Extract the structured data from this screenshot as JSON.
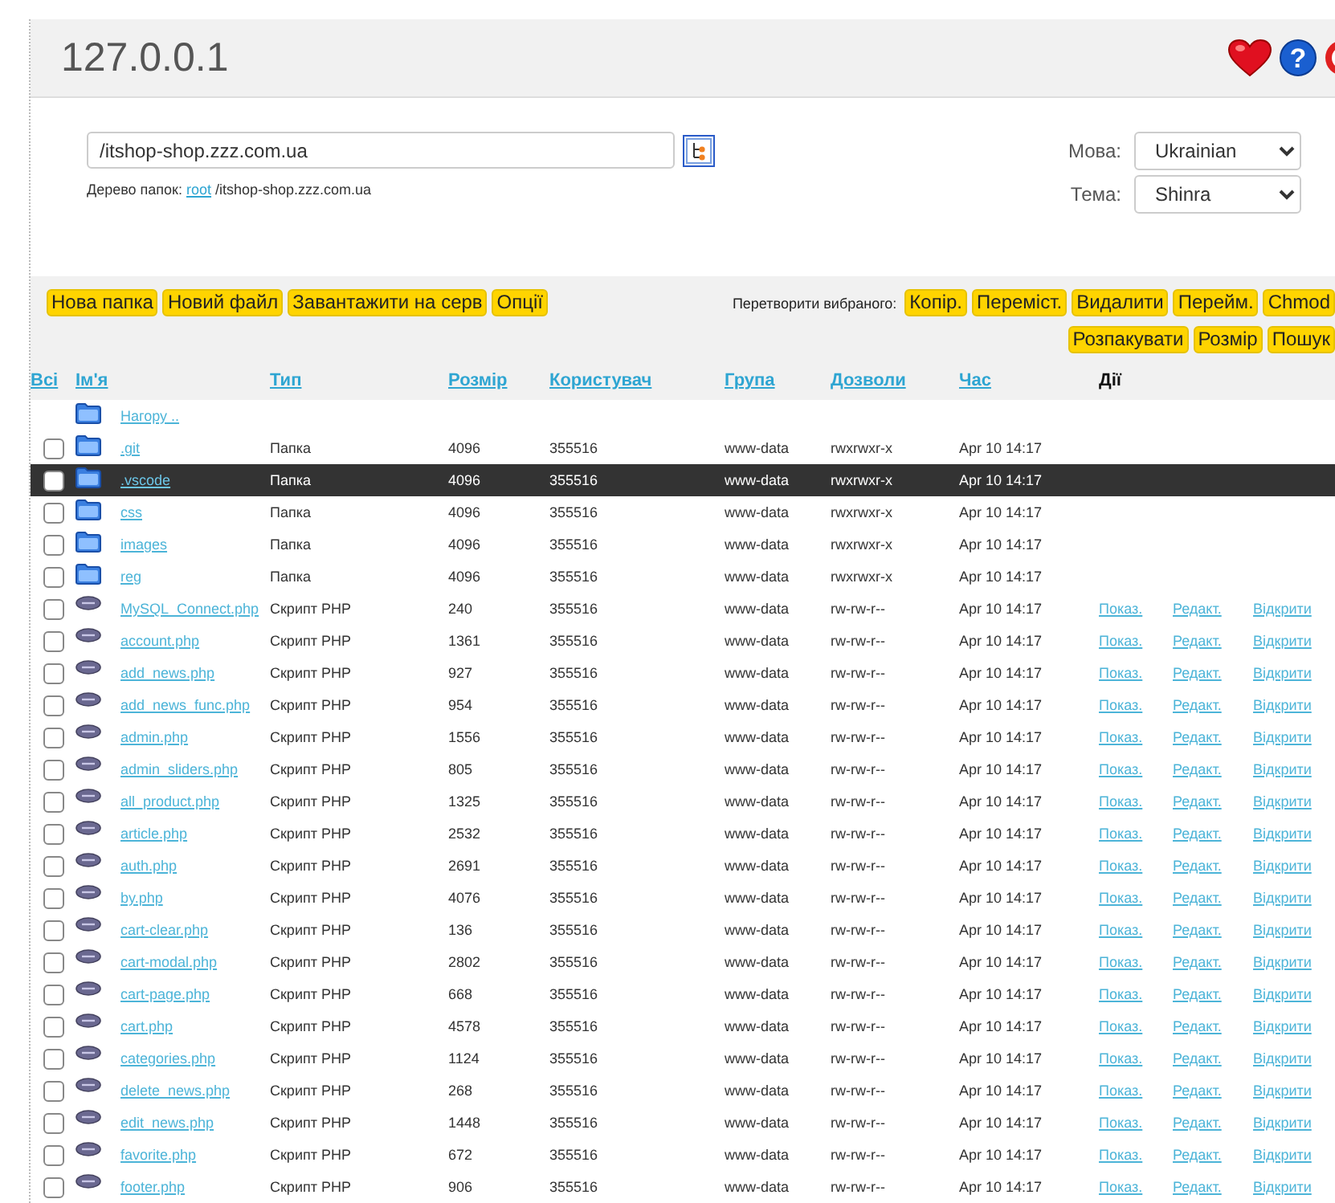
{
  "header": {
    "title": "127.0.0.1",
    "help_glyph": "?"
  },
  "path": {
    "value": "/itshop-shop.zzz.com.ua",
    "tree_label": "Дерево папок:",
    "tree_link": "root",
    "tree_path": "/itshop-shop.zzz.com.ua"
  },
  "settings": [
    {
      "label": "Мова:",
      "value": "Ukrainian"
    },
    {
      "label": "Тема:",
      "value": "Shinra"
    }
  ],
  "toolbar": {
    "buttons": [
      "Нова папка",
      "Новий файл",
      "Завантажити на серв",
      "Опції"
    ],
    "selection_label": "Перетворити вибраного:",
    "selection_rows": [
      [
        "Копір.",
        "Переміст.",
        "Видалити",
        "Перейм.",
        "Chmod"
      ],
      [
        "Розпакувати",
        "Розмір",
        "Пошук"
      ]
    ]
  },
  "table": {
    "columns": [
      {
        "label": "Всі",
        "link": true
      },
      {
        "label": "Ім'я",
        "link": true
      },
      {
        "label": "Тип",
        "link": true
      },
      {
        "label": "Розмір",
        "link": true
      },
      {
        "label": "Користувач",
        "link": true
      },
      {
        "label": "Група",
        "link": true
      },
      {
        "label": "Дозволи",
        "link": true
      },
      {
        "label": "Час",
        "link": true
      },
      {
        "label": "Дії",
        "link": false
      }
    ],
    "rows": [
      {
        "kind": "up",
        "name": "Нагору ..",
        "selected": false
      },
      {
        "kind": "folder",
        "name": ".git",
        "type": "Папка",
        "size": "4096",
        "user": "355516",
        "group": "www-data",
        "perms": "rwxrwxr-x",
        "time": "Apr 10 14:17",
        "checked": false,
        "selected": false
      },
      {
        "kind": "folder",
        "name": ".vscode",
        "type": "Папка",
        "size": "4096",
        "user": "355516",
        "group": "www-data",
        "perms": "rwxrwxr-x",
        "time": "Apr 10 14:17",
        "checked": false,
        "selected": true
      },
      {
        "kind": "folder",
        "name": "css",
        "type": "Папка",
        "size": "4096",
        "user": "355516",
        "group": "www-data",
        "perms": "rwxrwxr-x",
        "time": "Apr 10 14:17",
        "checked": false,
        "selected": false
      },
      {
        "kind": "folder",
        "name": "images",
        "type": "Папка",
        "size": "4096",
        "user": "355516",
        "group": "www-data",
        "perms": "rwxrwxr-x",
        "time": "Apr 10 14:17",
        "checked": false,
        "selected": false
      },
      {
        "kind": "folder",
        "name": "reg",
        "type": "Папка",
        "size": "4096",
        "user": "355516",
        "group": "www-data",
        "perms": "rwxrwxr-x",
        "time": "Apr 10 14:17",
        "checked": false,
        "selected": false
      },
      {
        "kind": "file",
        "name": "MySQL_Connect.php",
        "type": "Скрипт PHP",
        "size": "240",
        "user": "355516",
        "group": "www-data",
        "perms": "rw-rw-r--",
        "time": "Apr 10 14:17",
        "checked": false,
        "selected": false,
        "actions": [
          "Показ.",
          "Редакт.",
          "Відкрити"
        ]
      },
      {
        "kind": "file",
        "name": "account.php",
        "type": "Скрипт PHP",
        "size": "1361",
        "user": "355516",
        "group": "www-data",
        "perms": "rw-rw-r--",
        "time": "Apr 10 14:17",
        "checked": false,
        "selected": false,
        "actions": [
          "Показ.",
          "Редакт.",
          "Відкрити"
        ]
      },
      {
        "kind": "file",
        "name": "add_news.php",
        "type": "Скрипт PHP",
        "size": "927",
        "user": "355516",
        "group": "www-data",
        "perms": "rw-rw-r--",
        "time": "Apr 10 14:17",
        "checked": false,
        "selected": false,
        "actions": [
          "Показ.",
          "Редакт.",
          "Відкрити"
        ]
      },
      {
        "kind": "file",
        "name": "add_news_func.php",
        "type": "Скрипт PHP",
        "size": "954",
        "user": "355516",
        "group": "www-data",
        "perms": "rw-rw-r--",
        "time": "Apr 10 14:17",
        "checked": false,
        "selected": false,
        "actions": [
          "Показ.",
          "Редакт.",
          "Відкрити"
        ]
      },
      {
        "kind": "file",
        "name": "admin.php",
        "type": "Скрипт PHP",
        "size": "1556",
        "user": "355516",
        "group": "www-data",
        "perms": "rw-rw-r--",
        "time": "Apr 10 14:17",
        "checked": false,
        "selected": false,
        "actions": [
          "Показ.",
          "Редакт.",
          "Відкрити"
        ]
      },
      {
        "kind": "file",
        "name": "admin_sliders.php",
        "type": "Скрипт PHP",
        "size": "805",
        "user": "355516",
        "group": "www-data",
        "perms": "rw-rw-r--",
        "time": "Apr 10 14:17",
        "checked": false,
        "selected": false,
        "actions": [
          "Показ.",
          "Редакт.",
          "Відкрити"
        ]
      },
      {
        "kind": "file",
        "name": "all_product.php",
        "type": "Скрипт PHP",
        "size": "1325",
        "user": "355516",
        "group": "www-data",
        "perms": "rw-rw-r--",
        "time": "Apr 10 14:17",
        "checked": false,
        "selected": false,
        "actions": [
          "Показ.",
          "Редакт.",
          "Відкрити"
        ]
      },
      {
        "kind": "file",
        "name": "article.php",
        "type": "Скрипт PHP",
        "size": "2532",
        "user": "355516",
        "group": "www-data",
        "perms": "rw-rw-r--",
        "time": "Apr 10 14:17",
        "checked": false,
        "selected": false,
        "actions": [
          "Показ.",
          "Редакт.",
          "Відкрити"
        ]
      },
      {
        "kind": "file",
        "name": "auth.php",
        "type": "Скрипт PHP",
        "size": "2691",
        "user": "355516",
        "group": "www-data",
        "perms": "rw-rw-r--",
        "time": "Apr 10 14:17",
        "checked": false,
        "selected": false,
        "actions": [
          "Показ.",
          "Редакт.",
          "Відкрити"
        ]
      },
      {
        "kind": "file",
        "name": "by.php",
        "type": "Скрипт PHP",
        "size": "4076",
        "user": "355516",
        "group": "www-data",
        "perms": "rw-rw-r--",
        "time": "Apr 10 14:17",
        "checked": false,
        "selected": false,
        "actions": [
          "Показ.",
          "Редакт.",
          "Відкрити"
        ]
      },
      {
        "kind": "file",
        "name": "cart-clear.php",
        "type": "Скрипт PHP",
        "size": "136",
        "user": "355516",
        "group": "www-data",
        "perms": "rw-rw-r--",
        "time": "Apr 10 14:17",
        "checked": false,
        "selected": false,
        "actions": [
          "Показ.",
          "Редакт.",
          "Відкрити"
        ]
      },
      {
        "kind": "file",
        "name": "cart-modal.php",
        "type": "Скрипт PHP",
        "size": "2802",
        "user": "355516",
        "group": "www-data",
        "perms": "rw-rw-r--",
        "time": "Apr 10 14:17",
        "checked": false,
        "selected": false,
        "actions": [
          "Показ.",
          "Редакт.",
          "Відкрити"
        ]
      },
      {
        "kind": "file",
        "name": "cart-page.php",
        "type": "Скрипт PHP",
        "size": "668",
        "user": "355516",
        "group": "www-data",
        "perms": "rw-rw-r--",
        "time": "Apr 10 14:17",
        "checked": false,
        "selected": false,
        "actions": [
          "Показ.",
          "Редакт.",
          "Відкрити"
        ]
      },
      {
        "kind": "file",
        "name": "cart.php",
        "type": "Скрипт PHP",
        "size": "4578",
        "user": "355516",
        "group": "www-data",
        "perms": "rw-rw-r--",
        "time": "Apr 10 14:17",
        "checked": false,
        "selected": false,
        "actions": [
          "Показ.",
          "Редакт.",
          "Відкрити"
        ]
      },
      {
        "kind": "file",
        "name": "categories.php",
        "type": "Скрипт PHP",
        "size": "1124",
        "user": "355516",
        "group": "www-data",
        "perms": "rw-rw-r--",
        "time": "Apr 10 14:17",
        "checked": false,
        "selected": false,
        "actions": [
          "Показ.",
          "Редакт.",
          "Відкрити"
        ]
      },
      {
        "kind": "file",
        "name": "delete_news.php",
        "type": "Скрипт PHP",
        "size": "268",
        "user": "355516",
        "group": "www-data",
        "perms": "rw-rw-r--",
        "time": "Apr 10 14:17",
        "checked": false,
        "selected": false,
        "actions": [
          "Показ.",
          "Редакт.",
          "Відкрити"
        ]
      },
      {
        "kind": "file",
        "name": "edit_news.php",
        "type": "Скрипт PHP",
        "size": "1448",
        "user": "355516",
        "group": "www-data",
        "perms": "rw-rw-r--",
        "time": "Apr 10 14:17",
        "checked": false,
        "selected": false,
        "actions": [
          "Показ.",
          "Редакт.",
          "Відкрити"
        ]
      },
      {
        "kind": "file",
        "name": "favorite.php",
        "type": "Скрипт PHP",
        "size": "672",
        "user": "355516",
        "group": "www-data",
        "perms": "rw-rw-r--",
        "time": "Apr 10 14:17",
        "checked": false,
        "selected": false,
        "actions": [
          "Показ.",
          "Редакт.",
          "Відкрити"
        ]
      },
      {
        "kind": "file",
        "name": "footer.php",
        "type": "Скрипт PHP",
        "size": "906",
        "user": "355516",
        "group": "www-data",
        "perms": "rw-rw-r--",
        "time": "Apr 10 14:17",
        "checked": false,
        "selected": false,
        "actions": [
          "Показ.",
          "Редакт.",
          "Відкрити"
        ]
      }
    ]
  }
}
